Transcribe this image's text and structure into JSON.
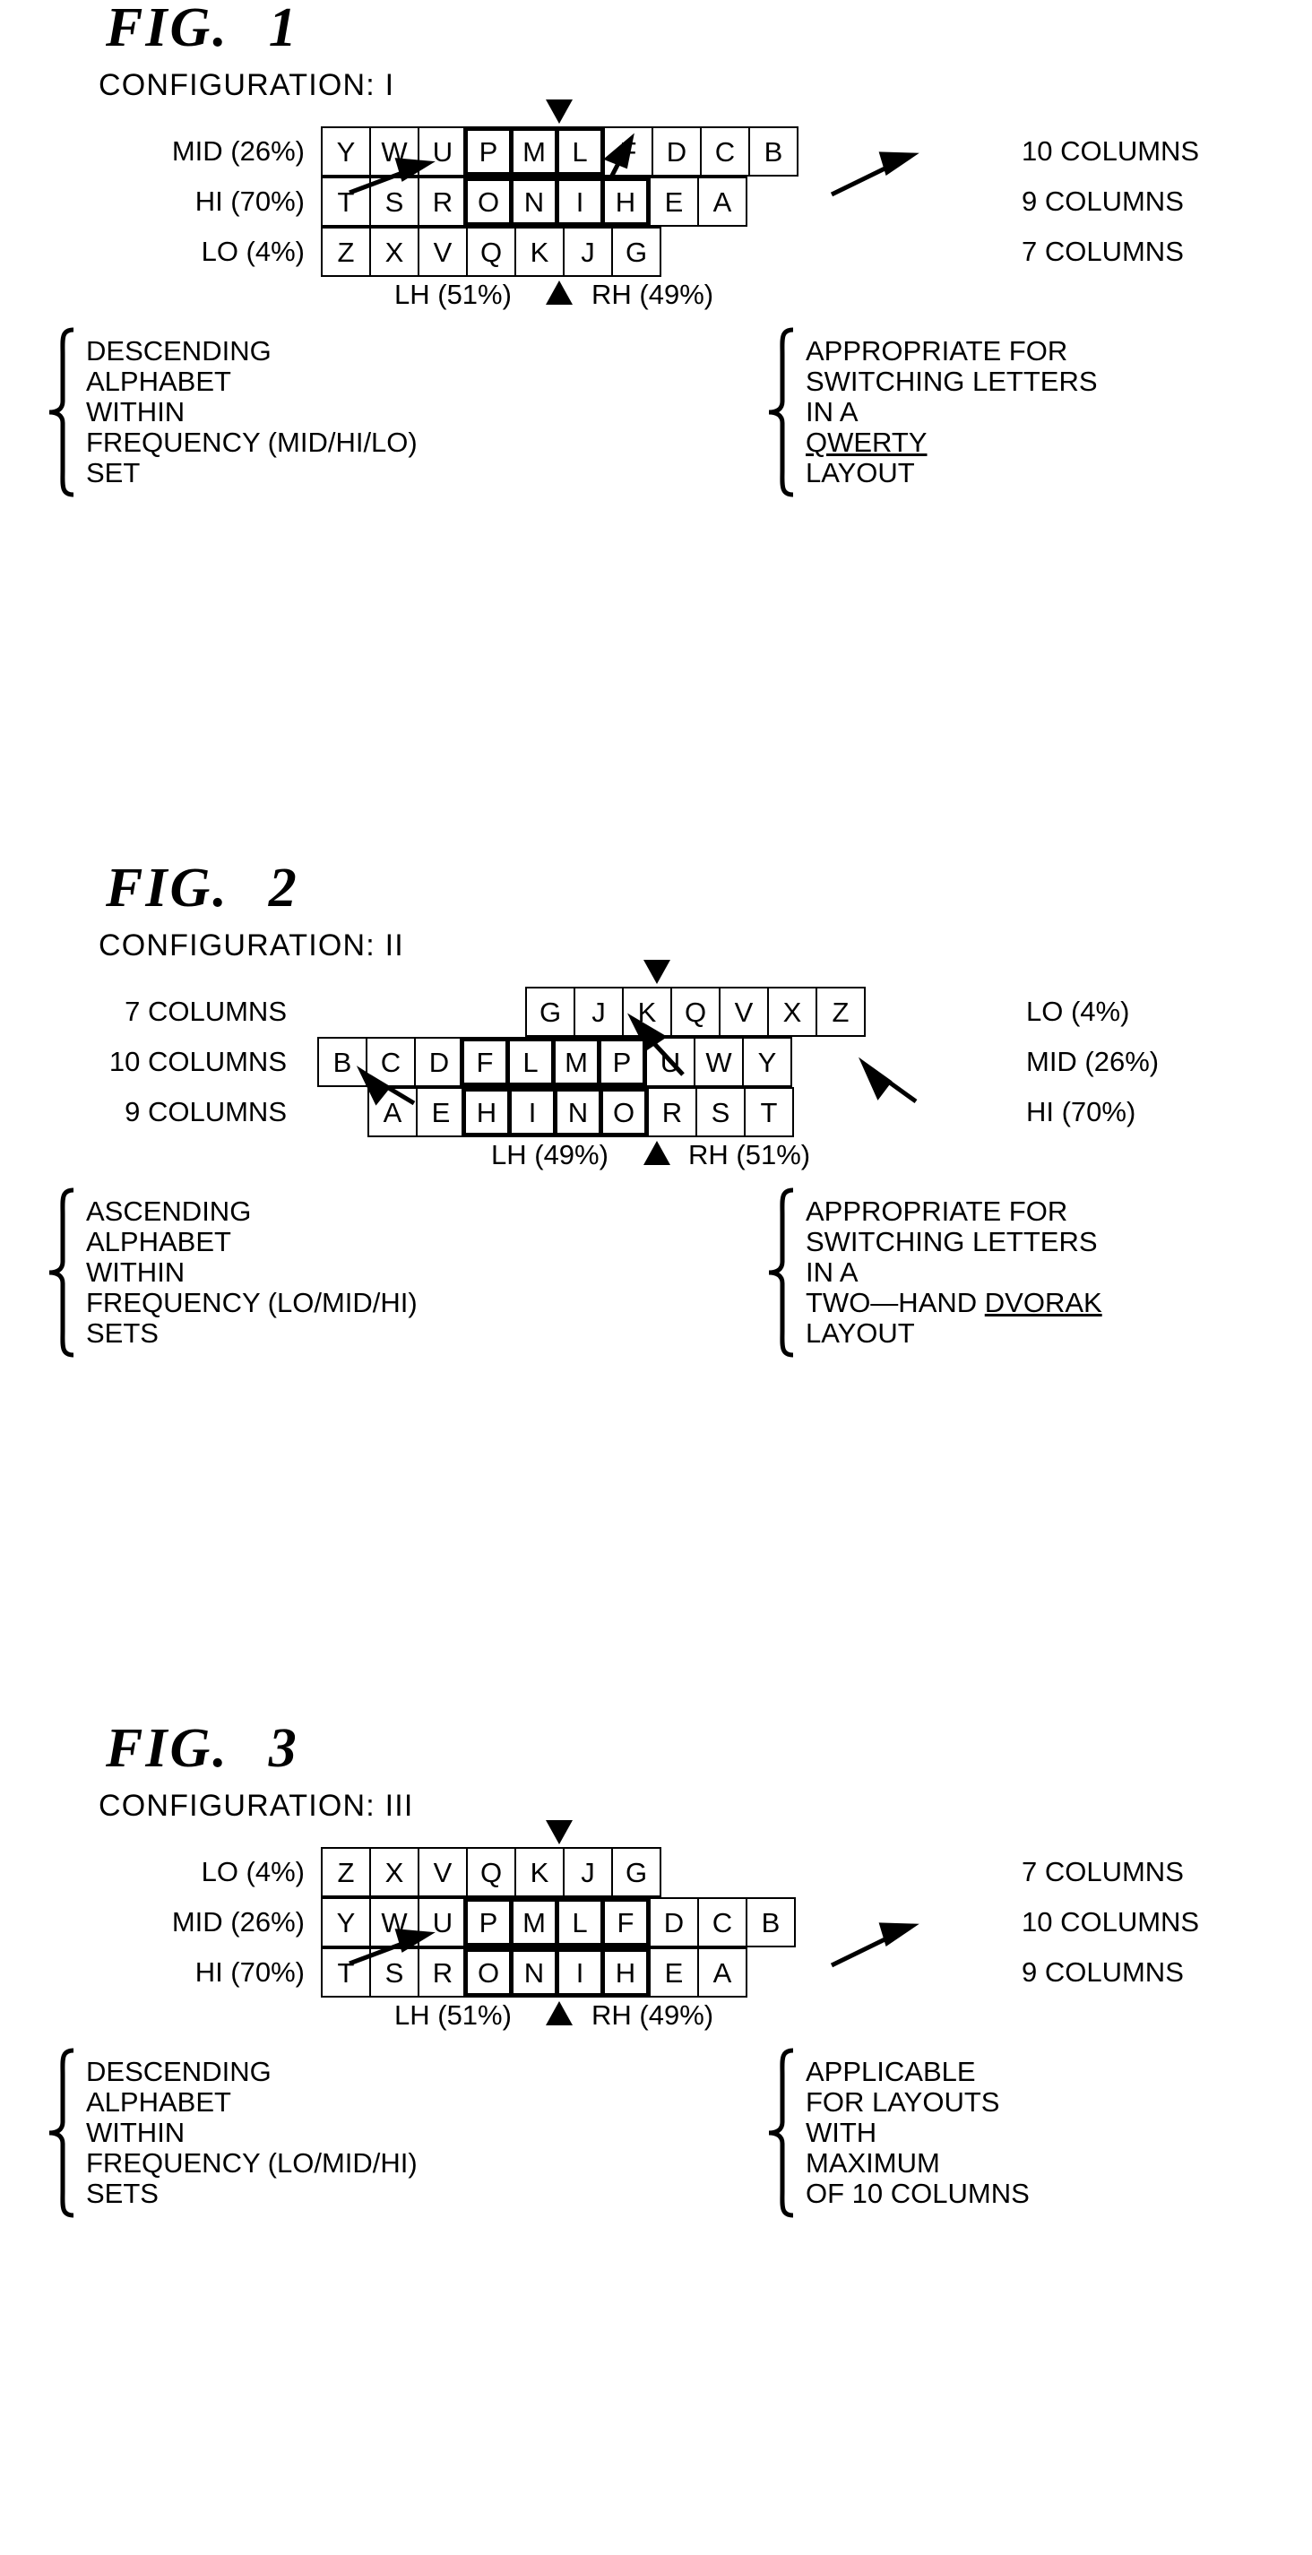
{
  "figures": [
    {
      "title": "FIG.",
      "number": "1",
      "config": "CONFIGURATION: I",
      "rows": [
        {
          "label_left": "MID (26%)",
          "label_right": "10 COLUMNS",
          "letters": [
            "Y",
            "W",
            "U",
            "P",
            "M",
            "L",
            "F",
            "D",
            "C",
            "B"
          ],
          "bold": [
            3,
            4,
            5
          ],
          "offset": 0
        },
        {
          "label_left": "HI (70%)",
          "label_right": "9 COLUMNS",
          "letters": [
            "T",
            "S",
            "R",
            "O",
            "N",
            "I",
            "H",
            "E",
            "A"
          ],
          "bold": [
            3,
            4,
            5,
            6
          ],
          "offset": 0
        },
        {
          "label_left": "LO (4%)",
          "label_right": "7 COLUMNS",
          "letters": [
            "Z",
            "X",
            "V",
            "Q",
            "K",
            "J",
            "G"
          ],
          "bold": [],
          "offset": 0
        }
      ],
      "hands": "LH (51%)   RH (49%)",
      "hand_left": "LH (51%)",
      "hand_right": "RH (49%)",
      "note_left": [
        "DESCENDING",
        "ALPHABET",
        "WITHIN",
        "FREQUENCY (MID/HI/LO)",
        "SET"
      ],
      "note_right": [
        "APPROPRIATE FOR",
        "SWITCHING LETTERS",
        "IN A",
        "QWERTY",
        "LAYOUT"
      ],
      "note_right_underline": [
        false,
        false,
        false,
        true,
        false
      ]
    },
    {
      "title": "FIG.",
      "number": "2",
      "config": "CONFIGURATION: II",
      "rows": [
        {
          "label_left": "7 COLUMNS",
          "label_right": "LO (4%)",
          "letters": [
            "G",
            "J",
            "K",
            "Q",
            "V",
            "X",
            "Z"
          ],
          "bold": [],
          "offset": 3
        },
        {
          "label_left": "10 COLUMNS",
          "label_right": "MID (26%)",
          "letters": [
            "B",
            "C",
            "D",
            "F",
            "L",
            "M",
            "P",
            "U",
            "W",
            "Y"
          ],
          "bold": [
            3,
            4,
            5,
            6
          ],
          "offset": 0
        },
        {
          "label_left": "9 COLUMNS",
          "label_right": "HI (70%)",
          "letters": [
            "A",
            "E",
            "H",
            "I",
            "N",
            "O",
            "R",
            "S",
            "T"
          ],
          "bold": [
            2,
            3,
            4,
            5
          ],
          "offset": 1
        }
      ],
      "hand_left": "LH (49%)",
      "hand_right": "RH (51%)",
      "note_left": [
        "ASCENDING",
        "ALPHABET",
        "WITHIN",
        "FREQUENCY (LO/MID/HI)",
        "SETS"
      ],
      "note_right": [
        "APPROPRIATE FOR",
        "SWITCHING LETTERS",
        "IN A",
        "TWO—HAND DVORAK",
        "LAYOUT"
      ],
      "note_right_underline": [
        false,
        false,
        false,
        false,
        false
      ]
    },
    {
      "title": "FIG.",
      "number": "3",
      "config": "CONFIGURATION: III",
      "rows": [
        {
          "label_left": "LO (4%)",
          "label_right": "7 COLUMNS",
          "letters": [
            "Z",
            "X",
            "V",
            "Q",
            "K",
            "J",
            "G"
          ],
          "bold": [],
          "offset": 0
        },
        {
          "label_left": "MID (26%)",
          "label_right": "10 COLUMNS",
          "letters": [
            "Y",
            "W",
            "U",
            "P",
            "M",
            "L",
            "F",
            "D",
            "C",
            "B"
          ],
          "bold": [
            3,
            4,
            5,
            6
          ],
          "offset": 0
        },
        {
          "label_left": "HI (70%)",
          "label_right": "9 COLUMNS",
          "letters": [
            "T",
            "S",
            "R",
            "O",
            "N",
            "I",
            "H",
            "E",
            "A"
          ],
          "bold": [
            3,
            4,
            5,
            6
          ],
          "offset": 0
        }
      ],
      "hand_left": "LH (51%)",
      "hand_right": "RH (49%)",
      "note_left": [
        "DESCENDING",
        "ALPHABET",
        "WITHIN",
        "FREQUENCY (LO/MID/HI)",
        "SETS"
      ],
      "note_right": [
        "APPLICABLE",
        "FOR LAYOUTS",
        "WITH",
        "MAXIMUM",
        "OF 10 COLUMNS"
      ],
      "note_right_underline": [
        false,
        false,
        false,
        false,
        false
      ]
    }
  ],
  "colors": {
    "ink": "#000000",
    "paper": "#ffffff"
  },
  "icons": {
    "marker_top": "triangle-down-icon",
    "marker_bottom": "triangle-up-icon",
    "brace": "curly-brace-icon",
    "arrow": "arrow-icon"
  }
}
